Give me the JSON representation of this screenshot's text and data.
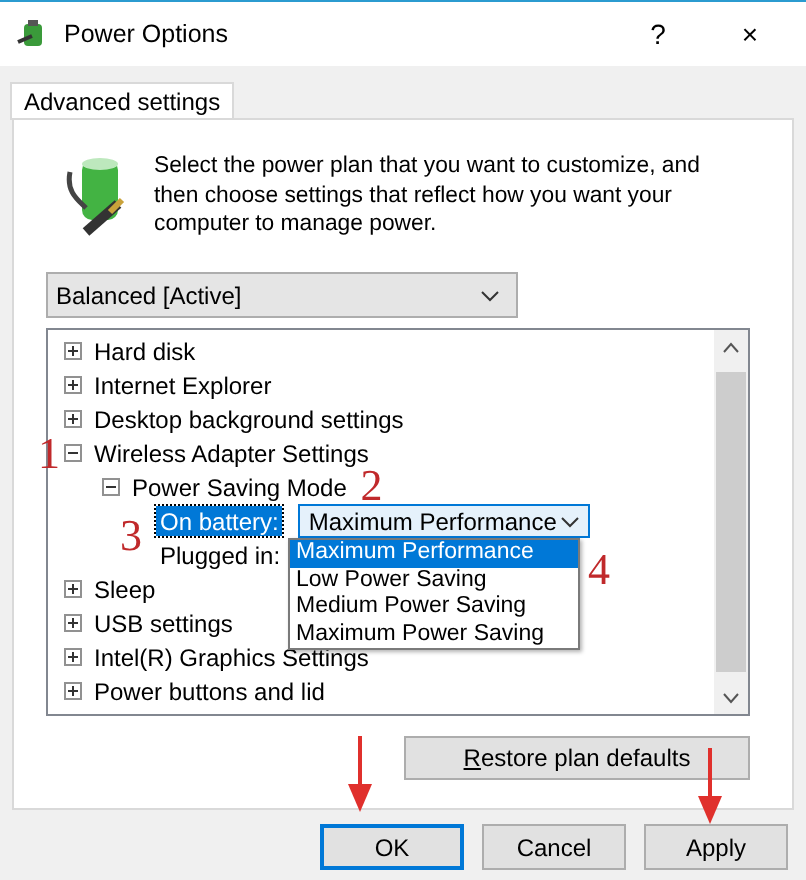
{
  "window": {
    "title": "Power Options",
    "help": "?",
    "close": "×"
  },
  "tabs": [
    {
      "label": "Advanced settings",
      "selected": true
    }
  ],
  "intro": "Select the power plan that you want to customize, and then choose settings that reflect how you want your computer to manage power.",
  "plan": {
    "value": "Balanced [Active]"
  },
  "tree": [
    {
      "label": "Hard disk",
      "expanded": false
    },
    {
      "label": "Internet Explorer",
      "expanded": false
    },
    {
      "label": "Desktop background settings",
      "expanded": false
    },
    {
      "label": "Wireless Adapter Settings",
      "expanded": true,
      "annotation": "1",
      "children": [
        {
          "label": "Power Saving Mode",
          "expanded": true,
          "annotation": "2",
          "children": [
            {
              "kind": "setting",
              "label": "On battery:",
              "selected": true,
              "value": "Maximum Performance",
              "annotation": "3",
              "options": [
                {
                  "label": "Maximum Performance",
                  "selected": true,
                  "annotation": "4"
                },
                {
                  "label": "Low Power Saving",
                  "selected": false
                },
                {
                  "label": "Medium Power Saving",
                  "selected": false
                },
                {
                  "label": "Maximum Power Saving",
                  "selected": false
                }
              ]
            },
            {
              "kind": "setting",
              "label": "Plugged in:",
              "selected": false
            }
          ]
        }
      ]
    },
    {
      "label": "Sleep",
      "expanded": false
    },
    {
      "label": "USB settings",
      "expanded": false
    },
    {
      "label": "Intel(R) Graphics Settings",
      "expanded": false
    },
    {
      "label": "Power buttons and lid",
      "expanded": false
    }
  ],
  "restore_button": {
    "label": "Restore plan defaults"
  },
  "buttons": [
    {
      "label": "OK",
      "default": true,
      "arrow": true
    },
    {
      "label": "Cancel",
      "default": false,
      "arrow": false
    },
    {
      "label": "Apply",
      "default": false,
      "arrow": true
    }
  ]
}
